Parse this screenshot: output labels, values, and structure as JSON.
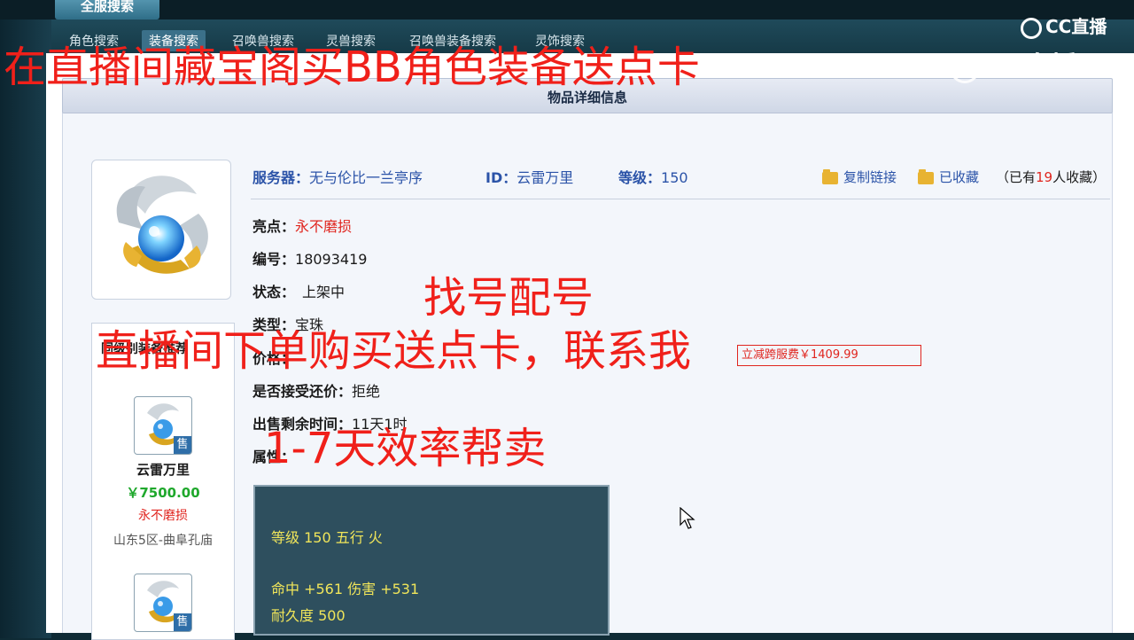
{
  "tabs": {
    "main": "全服搜索",
    "items": [
      "角色搜索",
      "装备搜索",
      "召唤兽搜索",
      "灵兽搜索",
      "召唤兽装备搜索",
      "灵饰搜索"
    ],
    "active_index": 1
  },
  "detail": {
    "header_title": "物品详细信息",
    "server_label": "服务器：",
    "server_value": "无与伦比一兰亭序",
    "id_label": "ID：",
    "id_value": "云雷万里",
    "level_label": "等级：",
    "level_value": "150",
    "copy_link": "复制链接",
    "collected": "已收藏",
    "fav_prefix": "（已有",
    "fav_count": "19",
    "fav_suffix": "人收藏）",
    "highlight_label": "亮点：",
    "highlight_value": "永不磨损",
    "serial_label": "编号：",
    "serial_value": "18093419",
    "status_label": "状态：",
    "status_value": "上架中",
    "type_label": "类型：",
    "type_value": "宝珠",
    "price_label": "价格：",
    "price_box_text": "立减跨服费￥1409.99",
    "bargain_label": "是否接受还价：",
    "bargain_value": "拒绝",
    "remaining_label": "出售剩余时间：",
    "remaining_value": "11天1时",
    "attr_label": "属性："
  },
  "attributes": {
    "line1": "等级 150 五行 火",
    "line2": "命中 +561 伤害 +531",
    "line3": "耐久度 500"
  },
  "side": {
    "heading": "同级别装备推荐",
    "badge": "售",
    "item1_name": "云雷万里",
    "item1_price": "￥7500.00",
    "item1_highlight": "永不磨损",
    "item1_server": "山东5区-曲阜孔庙"
  },
  "overlays": {
    "top_banner": "在直播间藏宝阁买BB角色装备送点卡",
    "line1": "找号配号",
    "line2": "直播间下单购买送点卡，联系我",
    "line3": "1-7天效率帮卖"
  },
  "watermark": {
    "logo_text": "CC直播"
  },
  "colors": {
    "overlay_red": "#f0201a",
    "link_blue": "#2b53a8",
    "attr_yellow": "#f0e55a",
    "price_green": "#1fa82c"
  }
}
